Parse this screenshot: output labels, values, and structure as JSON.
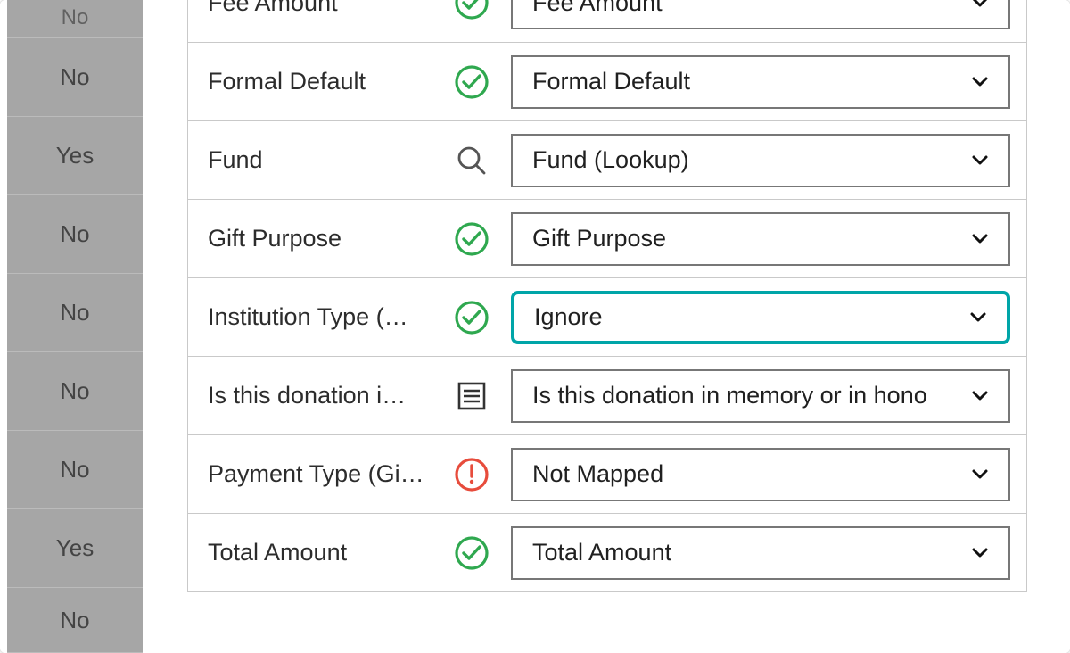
{
  "sidebar": {
    "partial_top": "No",
    "values": [
      "No",
      "Yes",
      "No",
      "No",
      "No",
      "No",
      "Yes",
      "No"
    ]
  },
  "rows": [
    {
      "label": "Fee Amount",
      "icon": "check",
      "value": "Fee Amount",
      "highlight": false
    },
    {
      "label": "Formal Default",
      "icon": "check",
      "value": "Formal Default",
      "highlight": false
    },
    {
      "label": "Fund",
      "icon": "search",
      "value": "Fund (Lookup)",
      "highlight": false
    },
    {
      "label": "Gift Purpose",
      "icon": "check",
      "value": "Gift Purpose",
      "highlight": false
    },
    {
      "label": "Institution Type (…",
      "icon": "check",
      "value": "Ignore",
      "highlight": true
    },
    {
      "label": "Is this donation i…",
      "icon": "list",
      "value": "Is this donation in memory or in hono",
      "highlight": false
    },
    {
      "label": "Payment Type (Gi…",
      "icon": "alert",
      "value": "Not Mapped",
      "highlight": false
    },
    {
      "label": "Total Amount",
      "icon": "check",
      "value": "Total Amount",
      "highlight": false
    }
  ]
}
